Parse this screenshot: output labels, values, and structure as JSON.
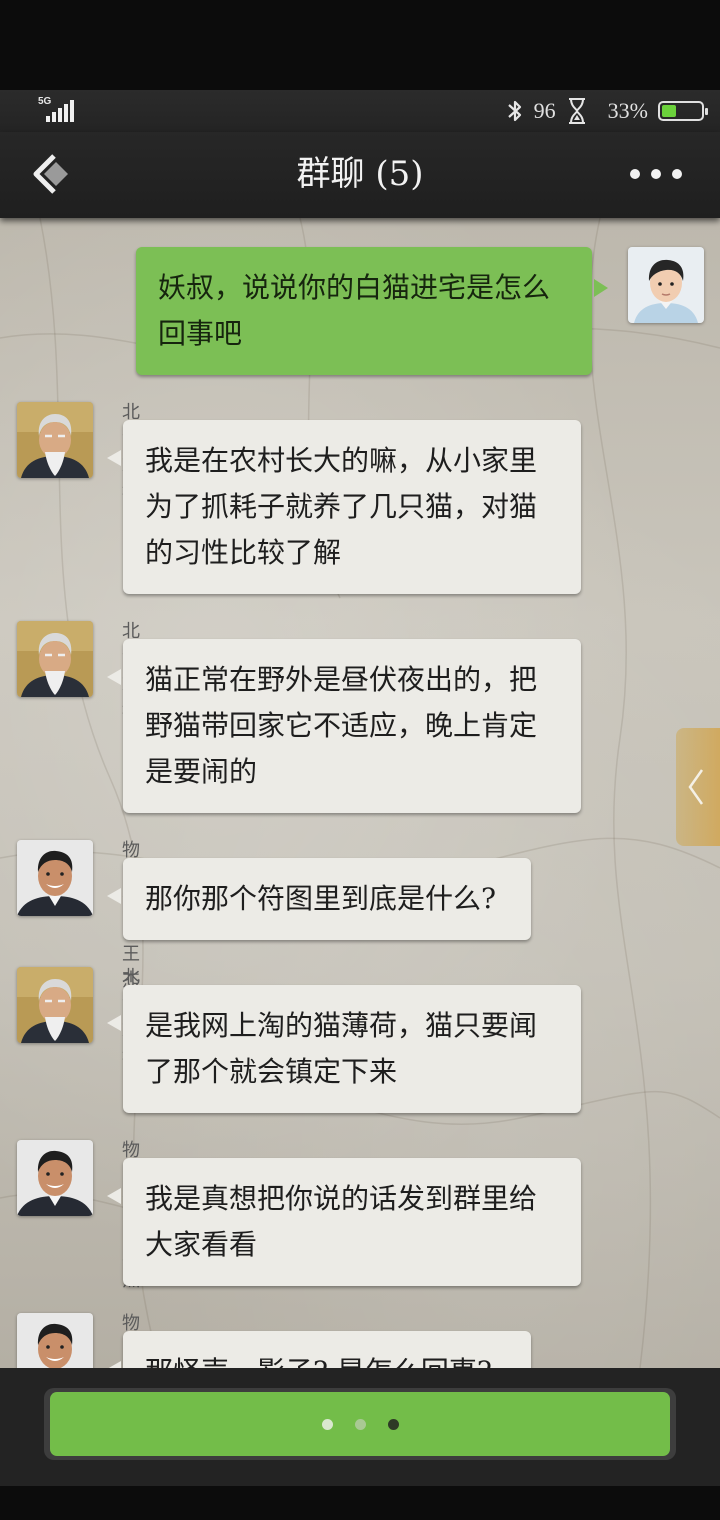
{
  "status_bar": {
    "network": "5G",
    "bluetooth_icon": "bluetooth-icon",
    "signal_value": "96",
    "hourglass_icon": "hourglass-icon",
    "battery_percent": "33%",
    "battery_level": 0.33,
    "battery_color": "#6bd13b"
  },
  "header": {
    "title": "群聊 (5)",
    "back_icon": "back-arrow-icon",
    "more_icon": "more-dots-icon"
  },
  "messages": [
    {
      "side": "out",
      "avatar": "young-man-avatar",
      "sender": "",
      "text": "妖叔，说说你的白猫进宅是怎么回事吧"
    },
    {
      "side": "in",
      "avatar": "old-man-avatar",
      "sender": "北派妖叔",
      "text": "我是在农村长大的嘛，从小家里为了抓耗子就养了几只猫，对猫的习性比较了解"
    },
    {
      "side": "in",
      "avatar": "old-man-avatar",
      "sender": "北派妖叔",
      "text": "猫正常在野外是昼伏夜出的，把野猫带回家它不适应，晚上肯定是要闹的"
    },
    {
      "side": "in",
      "avatar": "manager-avatar",
      "sender": "物业管家 王杰",
      "text": "那你那个符图里到底是什么?"
    },
    {
      "side": "in",
      "avatar": "old-man-avatar",
      "sender": "北派妖叔",
      "text": "是我网上淘的猫薄荷，猫只要闻了那个就会镇定下来"
    },
    {
      "side": "in",
      "avatar": "manager-avatar",
      "sender": "物业管家 王杰",
      "text": "我是真想把你说的话发到群里给大家看看"
    },
    {
      "side": "in",
      "avatar": "manager-avatar",
      "sender": "物业管家 王杰",
      "text": "那怪声、影子? 是怎么回事?"
    }
  ],
  "side_tab": {
    "icon": "chevron-left-icon"
  },
  "bottom": {
    "button_icon": "typing-dots-icon",
    "dot_colors": [
      "#d9e8cf",
      "#a9c994",
      "#2e3a26"
    ],
    "button_color": "#73bd49"
  },
  "colors": {
    "bubble_out": "#7cbf55",
    "bubble_in": "#ecebe6",
    "header": "#242424"
  }
}
